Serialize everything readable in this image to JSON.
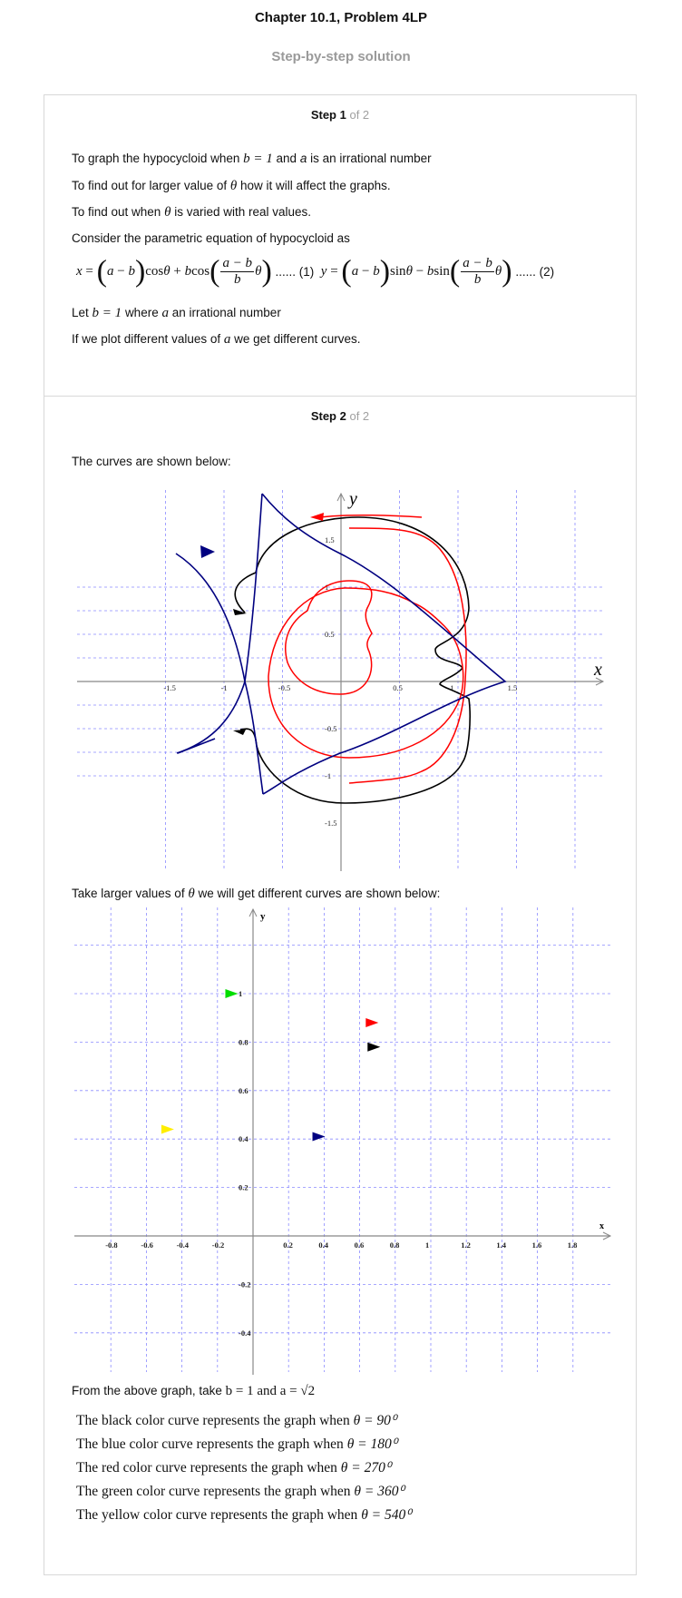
{
  "header": {
    "title": "Chapter 10.1, Problem 4LP",
    "subtitle": "Step-by-step solution"
  },
  "step1": {
    "label": "Step 1",
    "of": "of 2",
    "line1_a": "To graph the hypocycloid when",
    "line1_b": "b = 1",
    "line1_c": "and",
    "line1_d": "a",
    "line1_e": "is an irrational number",
    "line2_a": "To find out for larger value of",
    "line2_b": "θ",
    "line2_c": "how it will affect the graphs.",
    "line3_a": "To find out when",
    "line3_b": "θ",
    "line3_c": "is varied with real values.",
    "line4": "Consider the parametric equation of hypocycloid as",
    "eq1_tag": "...... (1)",
    "eq2_tag": "...... (2)",
    "line5_a": "Let",
    "line5_b": "b = 1",
    "line5_c": "where",
    "line5_d": "a",
    "line5_e": "an irrational number",
    "line6_a": "If we plot different values of",
    "line6_b": "a",
    "line6_c": "we get different curves."
  },
  "step2": {
    "label": "Step 2",
    "of": "of 2",
    "intro": "The curves are shown below:",
    "larger_a": "Take larger values of",
    "larger_b": "θ",
    "larger_c": "we will get different curves are shown below:",
    "from_a": "From the above graph, take",
    "from_b": "b = 1 and a = √2",
    "curves": [
      {
        "text": "The black color curve represents the graph when",
        "angle": "θ = 90⁰"
      },
      {
        "text": "The blue color curve represents the graph when",
        "angle": "θ = 180⁰"
      },
      {
        "text": "The red color curve represents the graph when",
        "angle": "θ = 270⁰"
      },
      {
        "text": "The green color curve represents the graph when",
        "angle": "θ = 360⁰"
      },
      {
        "text": "The yellow color curve represents the graph when",
        "angle": "θ = 540⁰"
      }
    ]
  },
  "graph1": {
    "x_label": "x",
    "y_label": "y",
    "x_ticks": [
      "-1.5",
      "-1",
      "-0.5",
      "0.5",
      "1",
      "1.5"
    ],
    "y_ticks": [
      "1.5",
      "1",
      "0.5",
      "-0.5",
      "-1",
      "-1.5"
    ]
  },
  "graph2": {
    "x_label": "x",
    "y_label": "y",
    "x_ticks": [
      "-0.8",
      "-0.6",
      "-0.4",
      "-0.2",
      "0.2",
      "0.4",
      "0.6",
      "0.8",
      "1",
      "1.2",
      "1.4",
      "1.6",
      "1.8"
    ],
    "y_ticks": [
      "1",
      "0.8",
      "0.6",
      "0.4",
      "0.2",
      "-0.2",
      "-0.4"
    ],
    "markers": [
      {
        "color": "#00dd00",
        "x": -0.12,
        "y": 1.0
      },
      {
        "color": "#ff0000",
        "x": 0.67,
        "y": 0.88
      },
      {
        "color": "#000000",
        "x": 0.68,
        "y": 0.78
      },
      {
        "color": "#ffee00",
        "x": -0.48,
        "y": 0.44
      },
      {
        "color": "#000080",
        "x": 0.37,
        "y": 0.41
      }
    ]
  },
  "colors": {
    "grid": "#8a8aff",
    "blue": "#000080",
    "red": "#ff0000",
    "black": "#000000"
  }
}
